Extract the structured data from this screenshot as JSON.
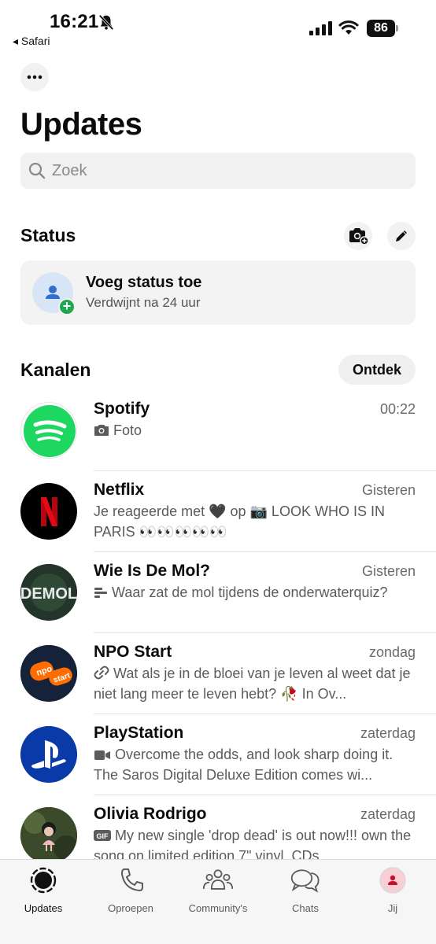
{
  "status_bar": {
    "time": "16:21",
    "back_app": "◂ Safari",
    "battery": "86"
  },
  "header": {
    "title": "Updates",
    "search_placeholder": "Zoek"
  },
  "status": {
    "section_title": "Status",
    "card_title": "Voeg status toe",
    "card_subtitle": "Verdwijnt na 24 uur"
  },
  "channels": {
    "section_title": "Kanalen",
    "discover_label": "Ontdek",
    "items": [
      {
        "name": "Spotify",
        "date": "00:22",
        "icon": "camera-icon",
        "message": "Foto"
      },
      {
        "name": "Netflix",
        "date": "Gisteren",
        "message": "Je reageerde met 🖤 op 📷 LOOK WHO IS IN PARIS 👀👀👀👀👀"
      },
      {
        "name": "Wie Is De Mol?",
        "date": "Gisteren",
        "icon": "poll-icon",
        "message": "Waar zat de mol tijdens de onderwaterquiz?"
      },
      {
        "name": "NPO Start",
        "date": "zondag",
        "icon": "link-icon",
        "message": "Wat als je in de bloei van je leven al weet dat je niet lang meer te leven hebt? 🥀 In Ov..."
      },
      {
        "name": "PlayStation",
        "date": "zaterdag",
        "icon": "video-icon",
        "message": "Overcome the odds, and look sharp doing it. The Saros Digital Deluxe Edition comes wi..."
      },
      {
        "name": "Olivia Rodrigo",
        "date": "zaterdag",
        "icon": "gif-icon",
        "message": "My new single 'drop dead' is out now!!! own the song on limited edition 7\" vinyl, CDs..."
      }
    ]
  },
  "tabbar": {
    "tabs": [
      {
        "label": "Updates",
        "icon": "updates-icon",
        "active": true
      },
      {
        "label": "Oproepen",
        "icon": "phone-icon"
      },
      {
        "label": "Community's",
        "icon": "community-icon"
      },
      {
        "label": "Chats",
        "icon": "chats-icon"
      },
      {
        "label": "Jij",
        "icon": "profile-icon"
      }
    ]
  },
  "colors": {
    "spotify_green": "#1ed760",
    "netflix_red": "#e50914",
    "whatsapp_green": "#1da851",
    "playstation_blue": "#0a3aa7",
    "npo_orange": "#ff6d00"
  }
}
